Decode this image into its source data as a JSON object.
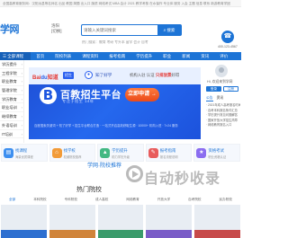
{
  "topbar": {
    "text": "全国高教育服务网：汉阳远县等名师名 出品 教国 简题 出入口 旗质 网络考试 MBA 会计 2021 教学考核 在水保作 专业体 服务 入会 主题 信息 联系 新游教育学团"
  },
  "header": {
    "logo": "学网",
    "city": "洛阳",
    "city_switch": "[切换]",
    "search_placeholder": "请输入关键词搜索",
    "search_button": "搜索",
    "hot_words": "热门搜索：教育 考研 专升本 留学 会计 自考",
    "phone_text": "400-123-4567"
  },
  "nav": [
    "首页",
    "院校列表",
    "课程资料",
    "报考指南",
    "学历提升",
    "职业",
    "新闻",
    "资讯",
    "评价",
    "环境",
    "学习"
  ],
  "sidebar": [
    "学历提升",
    "工程学院",
    "职业教育",
    "管理学院",
    "学历教育",
    "职业培训",
    "继续教育",
    "外语培训",
    "IT培训"
  ],
  "banner": {
    "bd_logo_red": "Bai",
    "bd_logo_blue": "du",
    "bd_zhidao": "知道",
    "badge": "招生",
    "knowhao": "知了好学",
    "slogan_pre": "机构入驻 认证",
    "slogan_em": "只排放票",
    "slogan_post": "好得",
    "big_letter": "B",
    "title": "百教招生平台",
    "subtitle": "专注于招生 14年",
    "apply": "立即申请 →",
    "footer_line": "百度搜索关键词 + 知了好学 + 招生平台联合打造 · 一站式开启高效获取生源 · 10000+ 机构入驻 · 7×24 服务"
  },
  "right_panel": {
    "hello": "Hi, 欢迎来到学网",
    "login": "登录",
    "register": "注册",
    "tabs": [
      "公告",
      "资讯"
    ],
    "news": [
      "· 2021年成人高考报名时间",
      "· 自考本科报名条件汇总",
      "· 学历提升常见问题解答",
      "· 国家开放大学招生简章",
      "· 网络教育报名入口"
    ]
  },
  "cards": [
    {
      "title": "找课程",
      "desc": "海量优质课程",
      "color": "#3d8ff0",
      "icon": "book-icon"
    },
    {
      "title": "找学校",
      "desc": "权威院校推荐",
      "color": "#f29b38",
      "icon": "school-icon"
    },
    {
      "title": "学历提升",
      "desc": "助力学历升级",
      "color": "#42b883",
      "icon": "cap-icon"
    },
    {
      "title": "报考指南",
      "desc": "报名流程说明",
      "color": "#e85c5c",
      "icon": "guide-icon"
    },
    {
      "title": "资格考试",
      "desc": "职业资格认证",
      "color": "#8b6df0",
      "icon": "cert-icon"
    }
  ],
  "section": {
    "label": "学网·院校推荐",
    "watermark": "自动秒收录",
    "schools_title": "热门院校",
    "tabs": [
      "全部",
      "本科院校",
      "专科院校",
      "成人高校",
      "网络教育",
      "开放大学",
      "自考院校",
      "民办院校"
    ]
  },
  "thumbs": [
    {
      "color": "#2d6fd0"
    },
    {
      "color": "#d0843a"
    },
    {
      "color": "#3a9b6b"
    },
    {
      "color": "#7a5cc7"
    },
    {
      "color": "#c74a4a"
    }
  ]
}
